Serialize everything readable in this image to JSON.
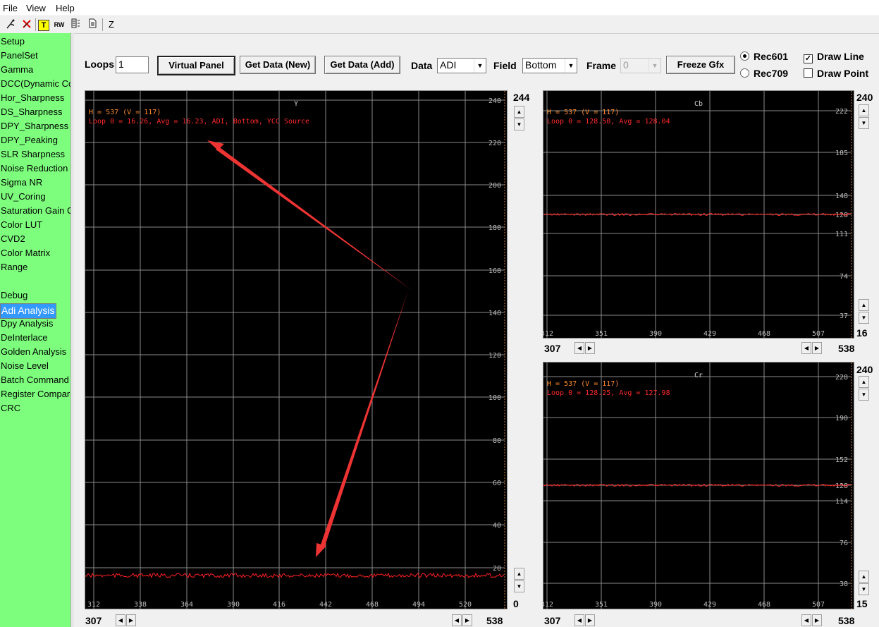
{
  "menu": [
    "File",
    "View",
    "Help"
  ],
  "toolbar": {
    "icons": [
      "connect-icon",
      "disconnect-icon",
      "text-t-icon",
      "rw-icon",
      "register-list-icon",
      "document-icon",
      "z-icon"
    ],
    "rw_text": "RW",
    "t_text": "T",
    "z_text": "Z"
  },
  "sidebar": {
    "items": [
      "Setup",
      "PanelSet",
      "Gamma",
      "DCC(Dynamic Co",
      "Hor_Sharpness",
      "DS_Sharpness",
      "DPY_Sharpness",
      "DPY_Peaking",
      "SLR Sharpness",
      "Noise Reduction",
      "Sigma NR",
      "UV_Coring",
      "Saturation Gain C",
      "Color LUT",
      "CVD2",
      "Color Matrix",
      "Range",
      "",
      "Debug",
      "Adi Analysis",
      "Dpy Analysis",
      "DeInterlace",
      "Golden Analysis",
      "Noise Level",
      "Batch Command",
      "Register Compar",
      "CRC"
    ],
    "selected": "Adi Analysis"
  },
  "controls": {
    "loops_label": "Loops",
    "loops_value": "1",
    "virtual_panel": "Virtual Panel",
    "get_data_new": "Get Data (New)",
    "get_data_add": "Get Data (Add)",
    "data_label": "Data",
    "data_value": "ADI",
    "field_label": "Field",
    "field_value": "Bottom",
    "frame_label": "Frame",
    "frame_value": "0",
    "freeze_gfx": "Freeze Gfx",
    "rec601": "Rec601",
    "rec709": "Rec709",
    "rec_selected": "Rec601",
    "draw_line": "Draw Line",
    "draw_line_checked": true,
    "draw_point": "Draw Point",
    "draw_point_checked": false
  },
  "colors": {
    "sidebar": "#7dff7d",
    "plot_bg": "#000000",
    "grid": "#8a8a8a",
    "trace": "#ff2020",
    "info_text": "#ff2a2a",
    "info_h": "#ff8a2a",
    "arrow": "#ee3333",
    "selected": "#3399ff"
  },
  "plots": {
    "y": {
      "title": "Y",
      "info_h": "H = 537 (V = 117)",
      "info_loop": "Loop 0 = 16.26, Avg = 16.23, ADI, Bottom, YCC Source",
      "y_ticks": [
        "240",
        "220",
        "200",
        "180",
        "160",
        "140",
        "120",
        "100",
        "80",
        "60",
        "40",
        "20"
      ],
      "x_ticks": [
        "312",
        "338",
        "364",
        "390",
        "416",
        "442",
        "468",
        "494",
        "520"
      ],
      "scale_top": "244",
      "scale_bottom": "0",
      "x_start": "307",
      "x_end": "538"
    },
    "cb": {
      "title": "Cb",
      "info_h": "H = 537 (V = 117)",
      "info_loop": "Loop 0 = 128.50, Avg = 128.04",
      "y_ticks": [
        "222",
        "185",
        "148",
        "128",
        "111",
        "74",
        "37"
      ],
      "x_ticks": [
        "312",
        "351",
        "390",
        "429",
        "468",
        "507"
      ],
      "scale_top": "240",
      "scale_bottom": "16",
      "x_start": "307",
      "x_end": "538"
    },
    "cr": {
      "title": "Cr",
      "info_h": "H = 537 (V = 117)",
      "info_loop": "Loop 0 = 128.25, Avg = 127.98",
      "y_ticks": [
        "228",
        "190",
        "152",
        "128",
        "114",
        "76",
        "38"
      ],
      "x_ticks": [
        "312",
        "351",
        "390",
        "429",
        "468",
        "507"
      ],
      "scale_top": "240",
      "scale_bottom": "15",
      "x_start": "307",
      "x_end": "538"
    }
  }
}
